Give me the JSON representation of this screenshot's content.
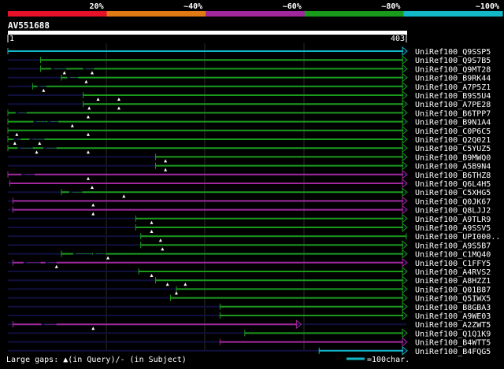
{
  "legend": {
    "bands": [
      {
        "label": "20%",
        "color": "#e5122a"
      },
      {
        "label": "~40%",
        "color": "#e07a14"
      },
      {
        "label": "~60%",
        "color": "#a0289c"
      },
      {
        "label": "~80%",
        "color": "#1a9a1a"
      },
      {
        "label": "~100%",
        "color": "#12b8c8"
      }
    ]
  },
  "query": {
    "id": "AV551688",
    "start": "1",
    "end": "403"
  },
  "colors": {
    "background": "#000000",
    "subject_faint": "#101040"
  },
  "hits": [
    {
      "label": "UniRef100_Q9SSP5",
      "start": 1,
      "end": 403,
      "color": "#12b8c8",
      "gaps": [],
      "arrow": true
    },
    {
      "label": "UniRef100_Q9S7B5",
      "start": 34,
      "end": 403,
      "color": "#1a9a1a",
      "gaps": [],
      "arrow": true
    },
    {
      "label": "UniRef100_Q9MT28",
      "start": 34,
      "end": 403,
      "color": "#1a9a1a",
      "gaps": [
        [
          48,
          60
        ],
        [
          80,
          88
        ]
      ],
      "arrow": true,
      "ins": [
        58,
        86
      ]
    },
    {
      "label": "UniRef100_B9RK44",
      "start": 55,
      "end": 403,
      "color": "#1a9a1a",
      "gaps": [
        [
          64,
          72
        ]
      ],
      "arrow": true,
      "ins": [
        80
      ]
    },
    {
      "label": "UniRef100_A7P5Z1",
      "start": 26,
      "end": 403,
      "color": "#1a9a1a",
      "gaps": [
        [
          34,
          40
        ]
      ],
      "arrow": true,
      "ins": [
        37
      ]
    },
    {
      "label": "UniRef100_B9S5U4",
      "start": 77,
      "end": 403,
      "color": "#1a9a1a",
      "gaps": [],
      "arrow": true,
      "ins": [
        92,
        113
      ]
    },
    {
      "label": "UniRef100_A7PE28",
      "start": 77,
      "end": 403,
      "color": "#1a9a1a",
      "gaps": [],
      "arrow": true,
      "ins": [
        83,
        113
      ]
    },
    {
      "label": "UniRef100_B6TPP7",
      "start": 1,
      "end": 403,
      "color": "#1a9a1a",
      "gaps": [
        [
          12,
          20
        ]
      ],
      "arrow": true,
      "ins": [
        82
      ]
    },
    {
      "label": "UniRef100_B9N1A4",
      "start": 1,
      "end": 403,
      "color": "#1a9a1a",
      "gaps": [
        [
          30,
          40
        ],
        [
          44,
          52
        ]
      ],
      "arrow": true,
      "ins": [
        66
      ]
    },
    {
      "label": "UniRef100_C0P6C5",
      "start": 1,
      "end": 403,
      "color": "#1a9a1a",
      "gaps": [],
      "arrow": true,
      "ins": [
        10,
        82
      ]
    },
    {
      "label": "UniRef100_Q2Q021",
      "start": 1,
      "end": 403,
      "color": "#1a9a1a",
      "gaps": [
        [
          10,
          14
        ],
        [
          26,
          38
        ]
      ],
      "arrow": true,
      "ins": [
        8,
        33
      ]
    },
    {
      "label": "UniRef100_C5YUZ5",
      "start": 1,
      "end": 403,
      "color": "#1a9a1a",
      "gaps": [
        [
          14,
          26
        ],
        [
          40,
          50
        ]
      ],
      "arrow": true,
      "ins": [
        30,
        82
      ]
    },
    {
      "label": "UniRef100_B9MWQ0",
      "start": 150,
      "end": 403,
      "color": "#1a9a1a",
      "gaps": [],
      "arrow": true,
      "ins": [
        160
      ]
    },
    {
      "label": "UniRef100_A5B9N4",
      "start": 150,
      "end": 403,
      "color": "#1a9a1a",
      "gaps": [],
      "arrow": true,
      "ins": [
        160
      ]
    },
    {
      "label": "UniRef100_B6THZ8",
      "start": 1,
      "end": 403,
      "color": "#a0289c",
      "gaps": [
        [
          18,
          28
        ]
      ],
      "arrow": true,
      "ins": [
        82
      ]
    },
    {
      "label": "UniRef100_Q6L4H5",
      "start": 3,
      "end": 403,
      "color": "#a0289c",
      "gaps": [],
      "arrow": true,
      "ins": [
        86
      ]
    },
    {
      "label": "UniRef100_C5XHG5",
      "start": 55,
      "end": 403,
      "color": "#1a9a1a",
      "gaps": [
        [
          66,
          76
        ]
      ],
      "arrow": true,
      "ins": [
        118
      ]
    },
    {
      "label": "UniRef100_Q0JK67",
      "start": 6,
      "end": 403,
      "color": "#a0289c",
      "gaps": [],
      "arrow": true,
      "ins": [
        87
      ]
    },
    {
      "label": "UniRef100_Q8LJJ2",
      "start": 6,
      "end": 403,
      "color": "#a0289c",
      "gaps": [],
      "arrow": true,
      "ins": [
        87
      ]
    },
    {
      "label": "UniRef100_A9TLR9",
      "start": 130,
      "end": 403,
      "color": "#1a9a1a",
      "gaps": [],
      "arrow": true,
      "ins": [
        146
      ]
    },
    {
      "label": "UniRef100_A9SSV5",
      "start": 130,
      "end": 403,
      "color": "#1a9a1a",
      "gaps": [],
      "arrow": true,
      "ins": [
        146
      ]
    },
    {
      "label": "UniRef100_UPI000..",
      "start": 135,
      "end": 403,
      "color": "#1a9a1a",
      "gaps": [],
      "arrow": false,
      "ins": [
        155
      ]
    },
    {
      "label": "UniRef100_A9S5B7",
      "start": 135,
      "end": 403,
      "color": "#1a9a1a",
      "gaps": [],
      "arrow": true,
      "ins": [
        157
      ]
    },
    {
      "label": "UniRef100_C1MQ40",
      "start": 55,
      "end": 403,
      "color": "#1a9a1a",
      "gaps": [
        [
          70,
          86
        ],
        [
          90,
          100
        ]
      ],
      "arrow": true,
      "ins": [
        102
      ]
    },
    {
      "label": "UniRef100_C1FFY5",
      "start": 6,
      "end": 403,
      "color": "#a0289c",
      "gaps": [
        [
          20,
          34
        ],
        [
          42,
          50
        ]
      ],
      "arrow": true,
      "ins": [
        50
      ]
    },
    {
      "label": "UniRef100_A4RVS2",
      "start": 133,
      "end": 403,
      "color": "#1a9a1a",
      "gaps": [],
      "arrow": true,
      "ins": [
        146
      ]
    },
    {
      "label": "UniRef100_A8HZZ1",
      "start": 150,
      "end": 403,
      "color": "#1a9a1a",
      "gaps": [],
      "arrow": true,
      "ins": [
        162,
        180
      ]
    },
    {
      "label": "UniRef100_Q01B87",
      "start": 171,
      "end": 403,
      "color": "#1a9a1a",
      "gaps": [],
      "arrow": true,
      "ins": [
        171
      ]
    },
    {
      "label": "UniRef100_Q5IWX5",
      "start": 165,
      "end": 403,
      "color": "#1a9a1a",
      "gaps": [],
      "arrow": true,
      "ins": []
    },
    {
      "label": "UniRef100_B8GBA3",
      "start": 215,
      "end": 403,
      "color": "#1a9a1a",
      "gaps": [],
      "arrow": true,
      "ins": []
    },
    {
      "label": "UniRef100_A9WE03",
      "start": 215,
      "end": 403,
      "color": "#1a9a1a",
      "gaps": [],
      "arrow": true,
      "ins": []
    },
    {
      "label": "UniRef100_A2ZWT5",
      "start": 6,
      "end": 296,
      "color": "#a0289c",
      "gaps": [
        [
          38,
          50
        ]
      ],
      "arrow": true,
      "ins": [
        87
      ]
    },
    {
      "label": "UniRef100_Q1Q1K9",
      "start": 240,
      "end": 403,
      "color": "#1a9a1a",
      "gaps": [],
      "arrow": true,
      "ins": []
    },
    {
      "label": "UniRef100_B4WTT5",
      "start": 215,
      "end": 403,
      "color": "#a0289c",
      "gaps": [],
      "arrow": true,
      "ins": []
    },
    {
      "label": "UniRef100_B4FQG5",
      "start": 315,
      "end": 403,
      "color": "#12b8c8",
      "gaps": [],
      "arrow": true,
      "ins": []
    }
  ],
  "footer": {
    "legend_text": "Large gaps: ▲(in Query)/- (in Subject)",
    "scale_text": "=100char.",
    "scale_color": "#12b8c8"
  }
}
